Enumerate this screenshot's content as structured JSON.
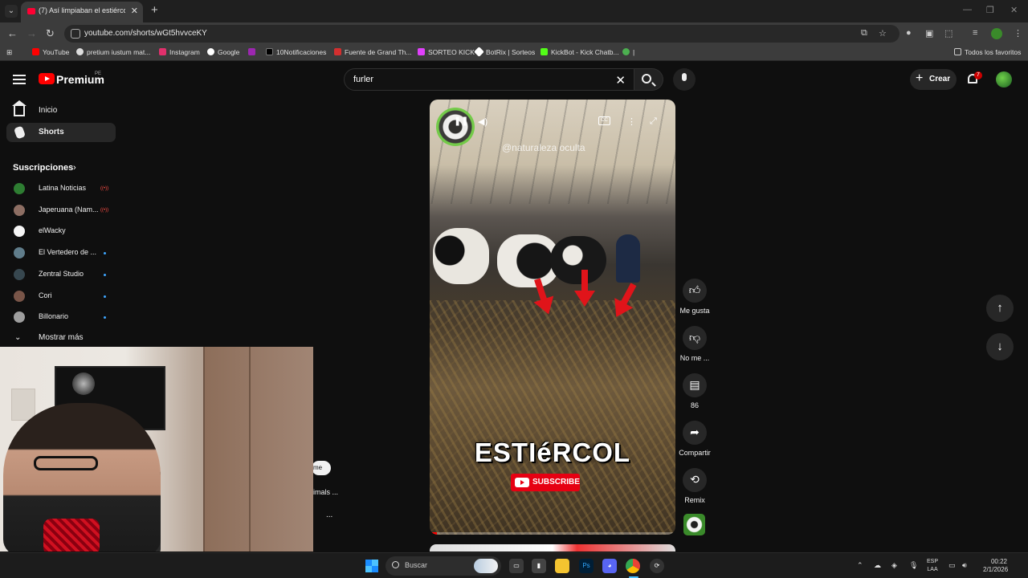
{
  "browser": {
    "tab_title": "(7) Así limpiaban el estiércol de",
    "url": "youtube.com/shorts/wGt5hvvceKY",
    "bookmarks": [
      "YouTube",
      "pretium iustum mat...",
      "Instagram",
      "Google",
      "10Notificaciones",
      "Fuente de Grand Th...",
      "SORTEO KICK",
      "BotRix | Sorteos",
      "KickBot - Kick Chatb...",
      "|"
    ],
    "all_bookmarks": "Todos los favoritos"
  },
  "masthead": {
    "brand": "Premium",
    "region": "PE",
    "search_value": "furler",
    "create_label": "Crear",
    "notification_count": "7"
  },
  "sidebar": {
    "items": [
      {
        "label": "Inicio",
        "icon": "home-icon"
      },
      {
        "label": "Shorts",
        "icon": "shorts-icon",
        "active": true
      }
    ],
    "subscriptions_title": "Suscripciones",
    "subscriptions": [
      {
        "label": "Latina Noticias",
        "status": "live",
        "color": "#2e7d32"
      },
      {
        "label": "Japeruana (Nam...",
        "status": "live",
        "color": "#8d6e63"
      },
      {
        "label": "elWacky",
        "status": "",
        "color": "#f5f5f5"
      },
      {
        "label": "El Vertedero de ...",
        "status": "new",
        "color": "#607d8b"
      },
      {
        "label": "Zentral Studio",
        "status": "new",
        "color": "#37474f"
      },
      {
        "label": "Cori",
        "status": "new",
        "color": "#795548"
      },
      {
        "label": "Billonario",
        "status": "new",
        "color": "#9e9e9e"
      }
    ],
    "show_more": "Mostrar más"
  },
  "peek": {
    "pill": "me",
    "text": "imals ...",
    "dots": "..."
  },
  "short": {
    "watermark": "@naturaleza oculta",
    "overlay_title": "ESTIéRCOL",
    "subscribe_badge": "SUBSCRIBE",
    "progress": 0.03
  },
  "actions": {
    "like_label": "Me gusta",
    "dislike_label": "No me ...",
    "comments_count": "86",
    "share_label": "Compartir",
    "remix_label": "Remix"
  },
  "taskbar": {
    "search_placeholder": "Buscar",
    "lang_line1": "ESP",
    "lang_line2": "LAA",
    "time": "00:22",
    "date": "2/1/2026"
  }
}
